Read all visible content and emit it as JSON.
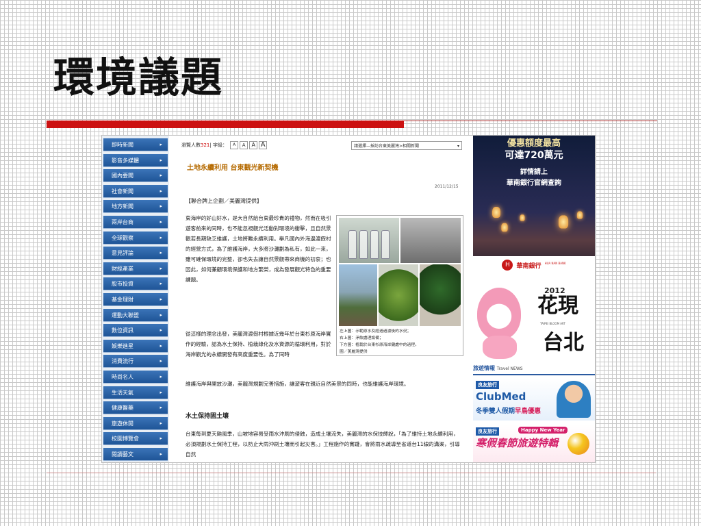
{
  "slide": {
    "title": "環境議題"
  },
  "nav": {
    "items": [
      "即時新聞",
      "影音多媒體",
      "國內要聞",
      "社會新聞",
      "地方新聞",
      "兩岸台商",
      "全球觀察",
      "意見評論",
      "財經產業",
      "股市投資",
      "基金理財",
      "運動大聯盟",
      "數位資訊",
      "娛樂進星",
      "消費流行",
      "時尚名人",
      "生活天氣",
      "健康醫藥",
      "旅遊休閒",
      "校園博覽會",
      "閱讀藝文"
    ]
  },
  "article": {
    "views_label": "瀏覽人數",
    "views_count": "321",
    "font_label": "| 字級：",
    "font_sizes": [
      "A",
      "A",
      "A",
      "A"
    ],
    "select_value": "請選擇—採訪台東美麗灣>相關新聞",
    "headline": "土地永續利用 台東觀光新契機",
    "date": "2011/12/15",
    "source": "【聯合牌上企劃／美麗灣提供】",
    "para1": "東海岸的好山好水，是大自然給台東最珍貴的禮物，然而在吸引遊客前來的同時，也不能忽視觀光活動對環境的衝擊，且自然景觀若長期缺乏維護，土地將難永續利用。舉凡國內外海邊渡假村的經營方式，為了維護海岸，大多將沙灘劃為私有，如此一來，雖可確保環境的完整，卻也失去讓自然景觀帶來商機的初衷；也因此，如何兼顧環境保護和地方繁榮，成為發展觀光特色的重要課題。",
    "para2": "從這樣的理念出發，美麗灣渡假村根據近幾年於台東杉原海岸實作的經驗，認為水土保持、植栽綠化及水資源的循環利用，對於海岸觀光的永續開發有高度重要性。為了同時",
    "para3": "維護海岸與開放沙灘，美麗灣規劃完善措施，讓遊客在親近自然美景的同時，也能維護海岸環境。",
    "section_title": "水土保持固土壤",
    "para4": "台東每到夏天颱風季，山坡地容易受雨水沖刷的侵蝕，造成土壤流失，美麗灣的水保技師說，「為了維持土地永續利用，必須規劃水土保持工程，以防止大雨沖刷土壤而引起災害。」工程施作的實踐，會將雨水疏導至省道台11線的溝渠，引導自然",
    "caption": [
      "左上圖：示範原水及經過過濾後的水況；",
      "右上圖：淨飲處理設備；",
      "下方圖：植栽於台東杉原海岸攤處中的過程。",
      "圖／美麗灣提供"
    ]
  },
  "ads": {
    "bank": {
      "top_text": "優惠額度最高",
      "amount": "可達720萬元",
      "line3": "詳情請上",
      "line4": "華南銀行官網查詢",
      "logo_name": "華南銀行",
      "logo_sub": "HUA NAN BANK"
    },
    "flora": {
      "year": "2012",
      "word1": "花現",
      "sub": "TAIPEI BLOOM ART",
      "word2": "台北"
    },
    "travel": {
      "title": "旅遊情報",
      "subtitle": "Travel NEWS"
    },
    "clubmed": {
      "brand": "良友旅行",
      "name": "ClubMed",
      "promo_a": "冬季雙人假期",
      "promo_b": "早鳥優惠"
    },
    "newyear": {
      "brand": "良友旅行",
      "badge": "Happy New Year",
      "deal": "寒假春節旅遊特輯"
    }
  },
  "colors": {
    "accent_red": "#cc1111",
    "nav_blue": "#2a64a8",
    "headline_orange": "#b56a00"
  }
}
